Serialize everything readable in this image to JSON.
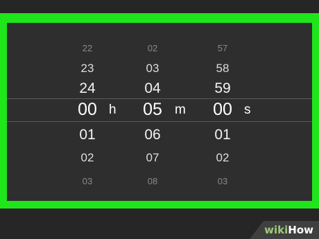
{
  "picker": {
    "hours": [
      "22",
      "23",
      "24",
      "00",
      "01",
      "02",
      "03"
    ],
    "minutes": [
      "02",
      "03",
      "04",
      "05",
      "06",
      "07",
      "08"
    ],
    "seconds": [
      "57",
      "58",
      "59",
      "00",
      "01",
      "02",
      "03"
    ],
    "units": {
      "hours": "h",
      "minutes": "m",
      "seconds": "s"
    }
  },
  "watermark": {
    "part1": "wiki",
    "part2": "How"
  },
  "colors": {
    "highlight_border": "#1fe51b",
    "background": "#2e2e2e"
  }
}
